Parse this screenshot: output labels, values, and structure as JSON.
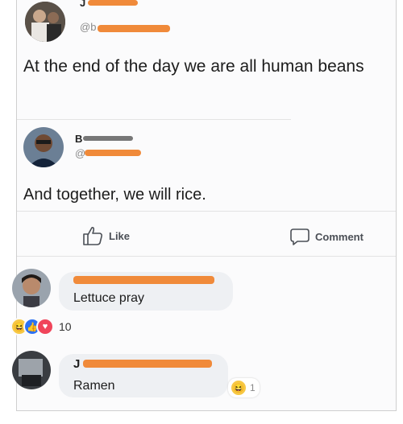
{
  "tweet1": {
    "name": "J",
    "handle": "@b",
    "text": "At the end of the day we are all human beans"
  },
  "tweet2": {
    "name": "B",
    "handle": "@",
    "text": "And together, we will rice."
  },
  "actions": {
    "like_label": "Like",
    "comment_label": "Comment"
  },
  "comments": [
    {
      "text": "Lettuce pray",
      "reaction_count": "10"
    },
    {
      "name": "J",
      "text": "Ramen",
      "reaction_count": "1"
    }
  ],
  "colors": {
    "redaction": "#f08a3a",
    "like_blue": "#2d72f3",
    "love_red": "#f0445a",
    "haha_yellow": "#f7c844"
  }
}
